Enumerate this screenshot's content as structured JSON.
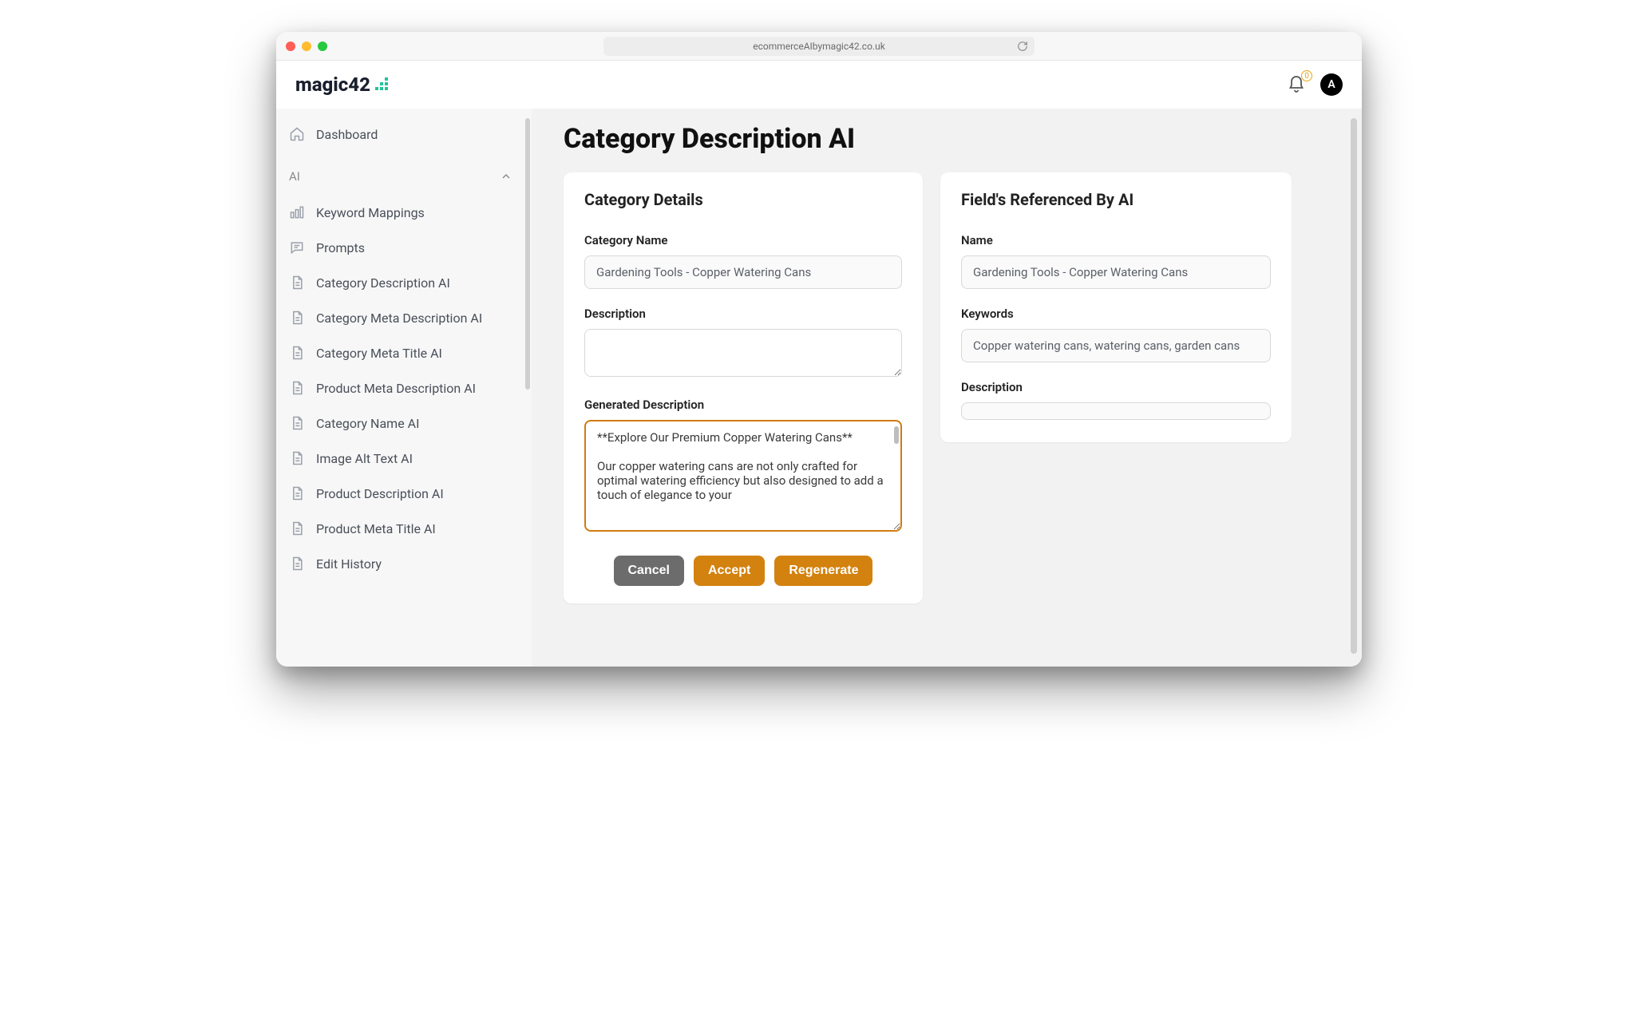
{
  "browser": {
    "url": "ecommerceAIbymagic42.co.uk"
  },
  "brand": {
    "name": "magic42"
  },
  "header": {
    "notification_count": "0",
    "avatar_initial": "A"
  },
  "sidebar": {
    "dashboard": "Dashboard",
    "section_ai": "AI",
    "items": [
      "Keyword Mappings",
      "Prompts",
      "Category Description AI",
      "Category Meta Description AI",
      "Category Meta Title AI",
      "Product Meta Description AI",
      "Category Name AI",
      "Image Alt Text AI",
      "Product Description AI",
      "Product Meta Title AI",
      "Edit History"
    ]
  },
  "page": {
    "title": "Category Description AI",
    "details_heading": "Category Details",
    "labels": {
      "category_name": "Category Name",
      "description": "Description",
      "generated": "Generated Description"
    },
    "category_name_value": "Gardening Tools - Copper Watering Cans",
    "description_value": "",
    "generated_value": "**Explore Our Premium Copper Watering Cans**\n\nOur copper watering cans are not only crafted for optimal watering efficiency but also designed to add a touch of elegance to your",
    "actions": {
      "cancel": "Cancel",
      "accept": "Accept",
      "regenerate": "Regenerate"
    }
  },
  "referenced": {
    "heading": "Field's Referenced By AI",
    "labels": {
      "name": "Name",
      "keywords": "Keywords",
      "description": "Description"
    },
    "name_value": "Gardening Tools - Copper Watering Cans",
    "keywords_value": "Copper watering cans, watering cans, garden cans",
    "description_value": ""
  }
}
